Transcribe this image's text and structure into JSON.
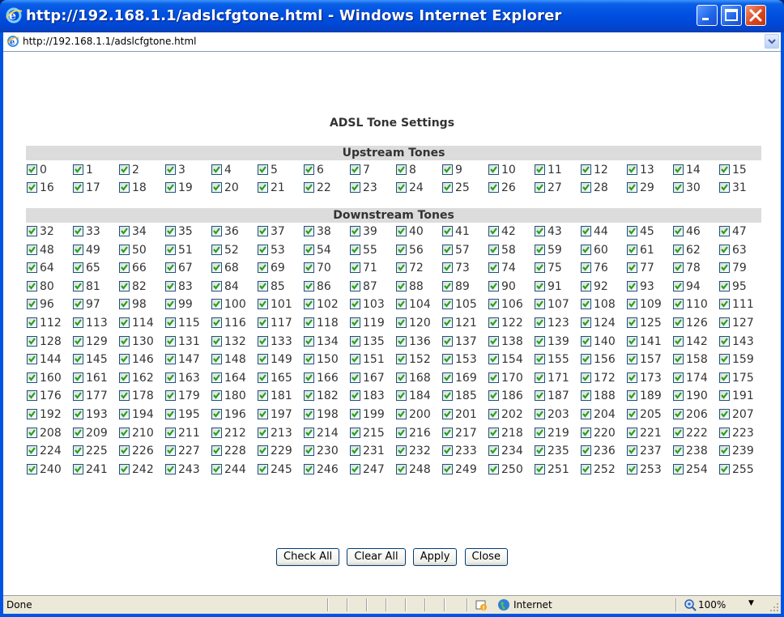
{
  "window": {
    "title": "http://192.168.1.1/adslcfgtone.html - Windows Internet Explorer",
    "address": "http://192.168.1.1/adslcfgtone.html"
  },
  "page": {
    "title": "ADSL Tone Settings",
    "upstream_label": "Upstream Tones",
    "downstream_label": "Downstream Tones",
    "tone_count": 256,
    "upstream_count": 32,
    "all_checked": true
  },
  "buttons": {
    "check_all": "Check All",
    "clear_all": "Clear All",
    "apply": "Apply",
    "close": "Close"
  },
  "status": {
    "text": "Done",
    "zone": "Internet",
    "zoom": "100%"
  },
  "colors": {
    "titlebar": "#0054e3",
    "section_bar": "#dcdcdc",
    "check": "#21a121"
  }
}
